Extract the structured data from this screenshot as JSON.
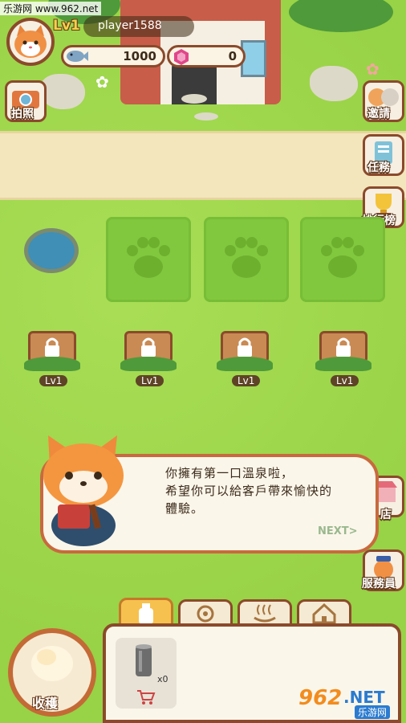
{
  "watermark": "乐游网 www.962.net",
  "header": {
    "level": "Lv1",
    "username": "player1588",
    "fish_count": "1000",
    "gem_count": "0",
    "icons": [
      "cat-avatar-icon",
      "fish-icon",
      "gem-icon"
    ]
  },
  "left_buttons": [
    {
      "label": "拍照",
      "icon": "camera-icon"
    }
  ],
  "right_buttons": [
    {
      "label": "邀請",
      "icon": "cats-icon"
    },
    {
      "label": "任務",
      "icon": "clipboard-icon"
    },
    {
      "label": "排行榜",
      "icon": "trophy-icon"
    },
    {
      "label": "店",
      "icon": "shop-icon"
    },
    {
      "label": "服務員",
      "icon": "waiter-cat-icon"
    }
  ],
  "plots": [
    {
      "icon": "paw-icon"
    },
    {
      "icon": "paw-icon"
    },
    {
      "icon": "paw-icon"
    }
  ],
  "locked_slots": [
    {
      "level": "Lv1"
    },
    {
      "level": "Lv1"
    },
    {
      "level": "Lv1"
    },
    {
      "level": "Lv1"
    }
  ],
  "dialog": {
    "lines": [
      "你擁有第一口溫泉啦，",
      "希望你可以給客戶帶來愉快的",
      "體驗。"
    ],
    "next_label": "NEXT>"
  },
  "tabs": [
    {
      "icon": "bottle-icon",
      "active": true
    },
    {
      "icon": "flower-icon",
      "active": false
    },
    {
      "icon": "hot-spring-icon",
      "active": false
    },
    {
      "icon": "house-icon",
      "active": false
    }
  ],
  "inventory": {
    "item_icon": "can-icon",
    "quantity": "x0",
    "cart_icon": "cart-icon"
  },
  "harvest": {
    "label": "收穫"
  },
  "logo": {
    "text_962": "962",
    "text_net": ".NET",
    "text_sub": "乐游网"
  },
  "colors": {
    "accent": "#8b4a2b",
    "grass": "#9fd84a",
    "plot": "#82c83e",
    "dialog_border": "#c86a3e",
    "gold": "#f2d24a"
  }
}
